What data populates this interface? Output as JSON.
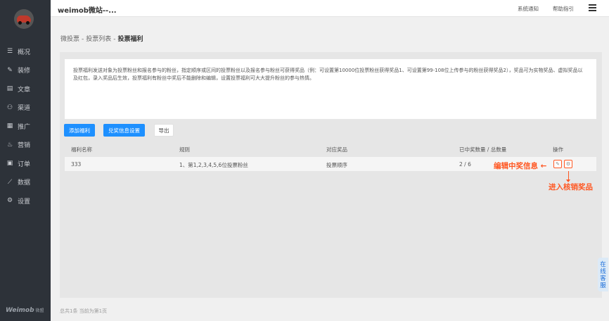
{
  "sidebar": {
    "items": [
      {
        "label": "概况",
        "icon": "overview-icon"
      },
      {
        "label": "装修",
        "icon": "decorate-icon"
      },
      {
        "label": "文章",
        "icon": "article-icon"
      },
      {
        "label": "渠道",
        "icon": "channel-icon"
      },
      {
        "label": "推广",
        "icon": "promote-icon"
      },
      {
        "label": "营销",
        "icon": "marketing-icon"
      },
      {
        "label": "订单",
        "icon": "order-icon"
      },
      {
        "label": "数据",
        "icon": "data-icon"
      },
      {
        "label": "设置",
        "icon": "settings-icon"
      }
    ],
    "brand": "Weimob",
    "brand_sub": "微盟"
  },
  "header": {
    "title": "weimob微站--...",
    "links": [
      "系统通知",
      "帮助指引"
    ]
  },
  "breadcrumb": [
    "微投票",
    "投票列表",
    "投票福利"
  ],
  "description": "投票福利发送对象为投票粉丝和报名参与的粉丝，指定顺序或区间的投票粉丝以及报名参与粉丝可获得奖品（例：可设置第10000位投票粉丝获得奖品1、可设置第99-108位上传参与的粉丝获得奖品2），奖品可为实物奖品、虚拟奖品以及红包，录入奖品后生效，投票福利有粉丝中奖后不能删除和编辑，设置投票福利可大大提升粉丝的参与热情。",
  "buttons": {
    "add": "添加福利",
    "prize_settings": "兑奖信息设置",
    "export": "导出"
  },
  "table": {
    "headers": [
      "福利名称",
      "规则",
      "对应奖品",
      "已中奖数量 / 总数量",
      "操作"
    ],
    "rows": [
      {
        "name": "333",
        "rule": "1、第1,2,3,4,5,6位投票粉丝",
        "prize": "投票顺序",
        "count": "2 / 6"
      }
    ]
  },
  "annotations": {
    "edit": "编辑中奖信息 ←",
    "verify": "进入核销奖品"
  },
  "footer": "总共1条 当前为第1页",
  "service": "在线客服",
  "colors": {
    "sidebar": "#2d3239",
    "primary": "#1e90ff",
    "annotation": "#ff5722"
  }
}
